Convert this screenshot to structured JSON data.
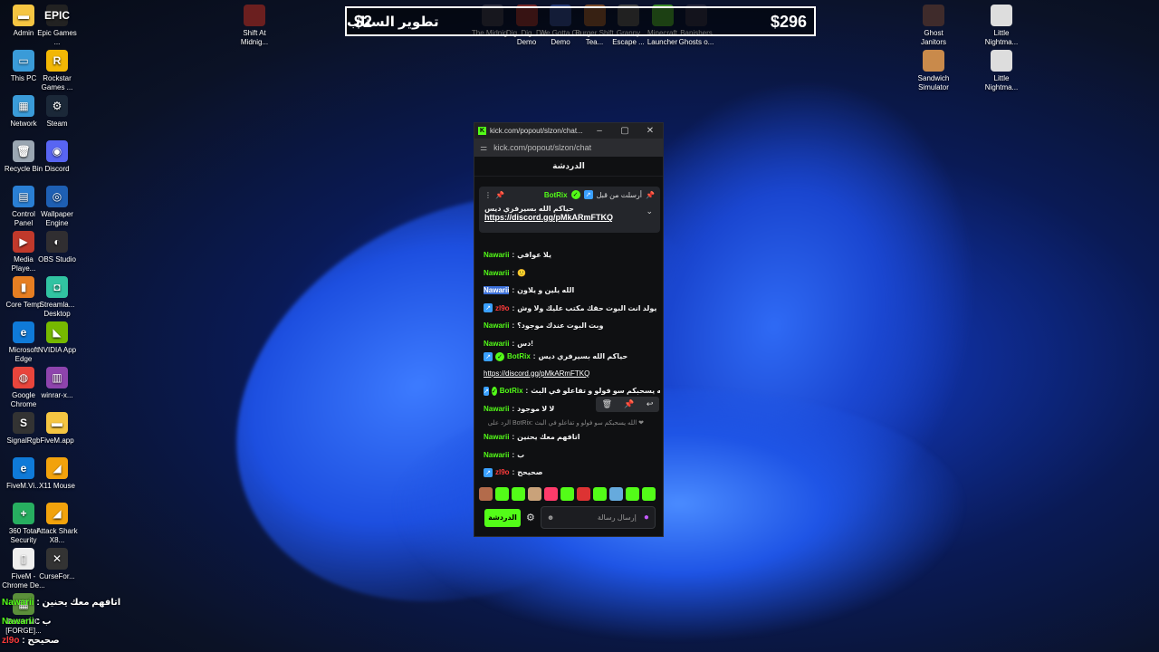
{
  "desktop_left": [
    {
      "label": "Admin",
      "icon": "folder-icon",
      "color": "#f5c542",
      "glyph": "▬"
    },
    {
      "label": "Epic Games ...",
      "icon": "epic-games-icon",
      "color": "#222222",
      "glyph": "EPIC"
    },
    {
      "label": "This PC",
      "icon": "monitor-icon",
      "color": "#3a9bd8",
      "glyph": "▭"
    },
    {
      "label": "Rockstar Games ...",
      "icon": "rockstar-icon",
      "color": "#f2b705",
      "glyph": "R"
    },
    {
      "label": "Network",
      "icon": "network-icon",
      "color": "#3a9bd8",
      "glyph": "▦"
    },
    {
      "label": "Steam",
      "icon": "steam-icon",
      "color": "#1b2838",
      "glyph": "⚙"
    },
    {
      "label": "Recycle Bin",
      "icon": "recycle-bin-icon",
      "color": "#9aa6b2",
      "glyph": "🗑"
    },
    {
      "label": "Discord",
      "icon": "discord-icon",
      "color": "#5865f2",
      "glyph": "◉"
    },
    {
      "label": "Control Panel",
      "icon": "control-panel-icon",
      "color": "#2a7fd4",
      "glyph": "▤"
    },
    {
      "label": "Wallpaper Engine",
      "icon": "wallpaper-engine-icon",
      "color": "#1e5fb3",
      "glyph": "◎"
    },
    {
      "label": "Media Playe...",
      "icon": "media-player-icon",
      "color": "#c0392b",
      "glyph": "▶"
    },
    {
      "label": "OBS Studio",
      "icon": "obs-icon",
      "color": "#302e31",
      "glyph": "◐"
    },
    {
      "label": "Core Temp",
      "icon": "core-temp-icon",
      "color": "#e67e22",
      "glyph": "▮"
    },
    {
      "label": "Streamla... Desktop",
      "icon": "streamlabs-icon",
      "color": "#31c3a2",
      "glyph": "◘"
    },
    {
      "label": "Microsoft Edge",
      "icon": "edge-icon",
      "color": "#0f7ad8",
      "glyph": "e"
    },
    {
      "label": "NVIDIA App",
      "icon": "nvidia-icon",
      "color": "#76b900",
      "glyph": "◣"
    },
    {
      "label": "Google Chrome",
      "icon": "chrome-icon",
      "color": "#e8453c",
      "glyph": "◍"
    },
    {
      "label": "winrar-x...",
      "icon": "winrar-icon",
      "color": "#8e44ad",
      "glyph": "▥"
    },
    {
      "label": "SignalRgb",
      "icon": "signalrgb-icon",
      "color": "#333333",
      "glyph": "S"
    },
    {
      "label": "FiveM.app",
      "icon": "folder-icon",
      "color": "#f5c542",
      "glyph": "▬"
    },
    {
      "label": "FiveM.Vi...",
      "icon": "edge-icon",
      "color": "#0f7ad8",
      "glyph": "e"
    },
    {
      "label": "X11 Mouse",
      "icon": "mouse-icon",
      "color": "#f2a20c",
      "glyph": "◢"
    },
    {
      "label": "360 Total Security",
      "icon": "security-icon",
      "color": "#27ae60",
      "glyph": "+"
    },
    {
      "label": "Attack Shark X8...",
      "icon": "attack-shark-icon",
      "color": "#f2a20c",
      "glyph": "◢"
    },
    {
      "label": "FiveM - Chrome De...",
      "icon": "document-icon",
      "color": "#eeeeee",
      "glyph": "▯"
    },
    {
      "label": "CurseFor...",
      "icon": "curseforge-icon",
      "color": "#333333",
      "glyph": "✕"
    },
    {
      "label": "Better MC [FORGE]...",
      "icon": "minecraft-icon",
      "color": "#5b8f3a",
      "glyph": "▦"
    }
  ],
  "desktop_top": [
    {
      "label": "Shift At Midnig...",
      "icon": "game-icon",
      "color": "#6b1f1f"
    },
    {
      "label": "The Midnig...",
      "icon": "game-icon",
      "color": "#333344"
    },
    {
      "label": "Dig, Dig, Die Demo",
      "icon": "game-icon",
      "color": "#7a2b2b"
    },
    {
      "label": "We Gotta Go Demo",
      "icon": "game-icon",
      "color": "#2b3f7a"
    },
    {
      "label": "Burger Shift Tea...",
      "icon": "game-icon",
      "color": "#7a4b2b"
    },
    {
      "label": "Granny Escape ...",
      "icon": "game-icon",
      "color": "#4b4b4b"
    },
    {
      "label": "Minecraft Launcher",
      "icon": "minecraft-icon",
      "color": "#3f8f2b"
    },
    {
      "label": "Banishers Ghosts o...",
      "icon": "game-icon",
      "color": "#2b2b3f"
    }
  ],
  "desktop_right": [
    {
      "label": "Ghost Janitors",
      "icon": "game-icon",
      "color": "#3f2b2b"
    },
    {
      "label": "Little Nightma...",
      "icon": "game-icon",
      "color": "#dddddd"
    },
    {
      "label": "Sandwich Simulator",
      "icon": "game-icon",
      "color": "#c98a4b"
    },
    {
      "label": "Little Nightma...",
      "icon": "game-icon",
      "color": "#dddddd"
    }
  ],
  "donation": {
    "left": "$2",
    "middle": "تطوير الستاب",
    "right": "$296"
  },
  "browser": {
    "title": "kick.com/popout/slzon/chat...",
    "url": "kick.com/popout/slzon/chat",
    "chat_title": "الدردشة"
  },
  "pinned": {
    "sent_by": "أرسلت من قبل",
    "user": "BotRix",
    "message": "حياكم الله بسيرفري ديس",
    "link": "https://discord.gg/pMkARmFTKQ"
  },
  "messages": [
    {
      "user": "Nawarii",
      "text": "يلا عوافي",
      "style": "green"
    },
    {
      "user": "Nawarii",
      "text": "🙂",
      "style": "green"
    },
    {
      "user": "Nawarii",
      "text": "الله يلين و يلاون",
      "style": "selected"
    },
    {
      "user": "zl9o",
      "text": "يولد انت البوت حقك مكتب عليك ولا وش",
      "style": "red"
    },
    {
      "user": "Nawarii",
      "text": "وبت البوت عندك موجود؟",
      "style": "green"
    },
    {
      "user": "Nawarii",
      "text": "دس!",
      "style": "green"
    },
    {
      "user": "BotRix",
      "text": "حياكم الله بسيرفري ديس",
      "style": "bot",
      "link": "https://discord.gg/pMkARmFTKQ"
    },
    {
      "user": "BotRix",
      "text": "الله يسحبكم سو فولو و تفاعلو في البث ❤",
      "style": "bot"
    },
    {
      "user": "Nawarii",
      "text": "لا لا موجود",
      "style": "green"
    },
    {
      "reply": "الرد على BotRix: الله يسحبكم سو فولو و تفاعلو في البث ❤"
    },
    {
      "user": "Nawarii",
      "text": "اتافهم معك يحنين",
      "style": "green"
    },
    {
      "user": "Nawarii",
      "text": "ب",
      "style": "green"
    },
    {
      "user": "zl9o",
      "text": "صحيحح",
      "style": "red"
    }
  ],
  "emote_colors": [
    "#b36b4b",
    "#53fc18",
    "#53fc18",
    "#c9a27a",
    "#ff3b6b",
    "#53fc18",
    "#d33",
    "#53fc18",
    "#6ad",
    "#53fc18",
    "#53fc18"
  ],
  "input": {
    "placeholder": "إرسال رسالة",
    "send_label": "الدردشة"
  },
  "overlay": [
    {
      "user": "Nawarii",
      "text": "اتافهم معك يحنين",
      "style": "green"
    },
    {
      "user": "Nawarii",
      "text": "ب",
      "style": "green"
    },
    {
      "user": "zl9o",
      "text": "صحيحح",
      "style": "red"
    }
  ]
}
